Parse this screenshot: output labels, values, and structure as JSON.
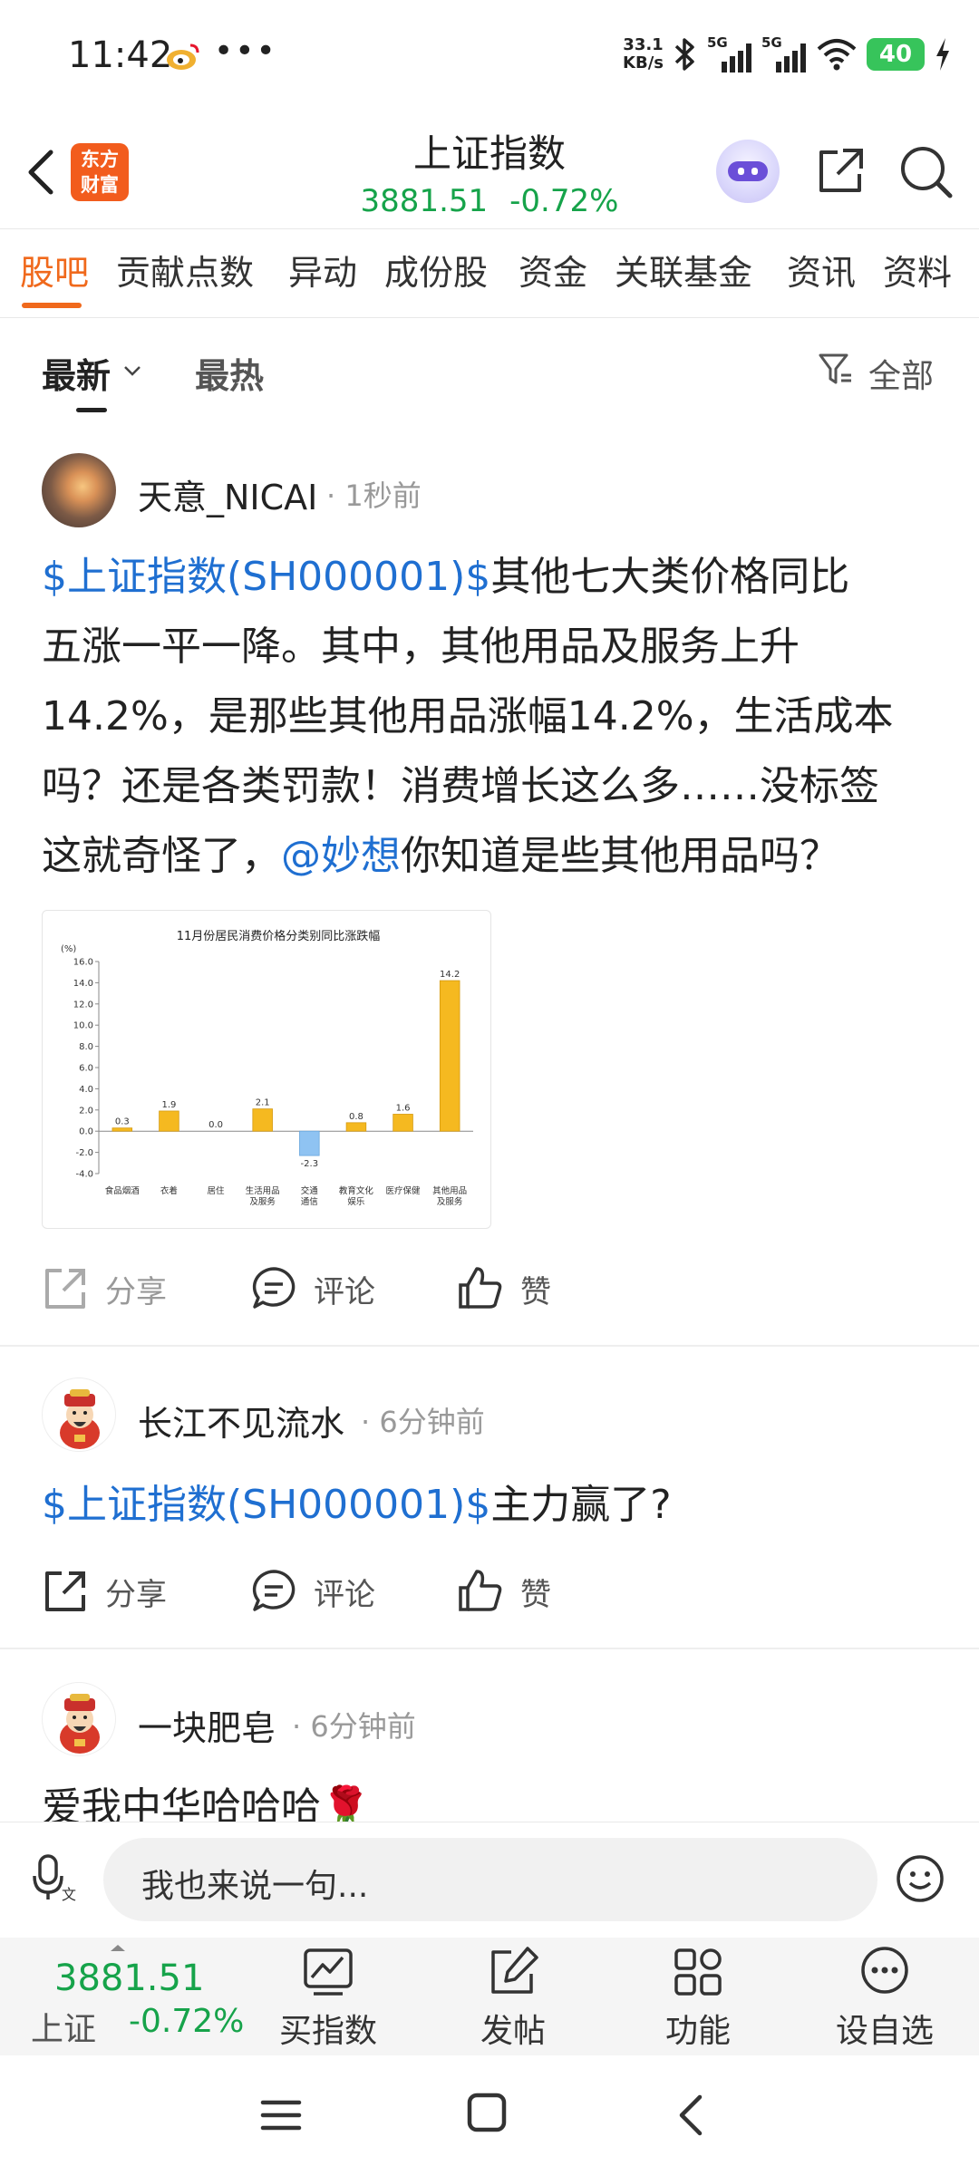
{
  "status_bar": {
    "time": "11:42",
    "net_speed_value": "33.1",
    "net_speed_unit": "KB/s",
    "battery": "40"
  },
  "header": {
    "logo_line1": "东方",
    "logo_line2": "财富",
    "title": "上证指数",
    "price": "3881.51",
    "change": "-0.72%"
  },
  "tabs": [
    "股吧",
    "贡献点数",
    "异动",
    "成份股",
    "资金",
    "关联基金",
    "资讯",
    "资料"
  ],
  "sort": {
    "latest": "最新",
    "hot": "最热",
    "filter": "全部"
  },
  "posts": [
    {
      "username": "天意_NICAI",
      "time": "· 1秒前",
      "link": "$上证指数(SH000001)$",
      "text_a": "其他七大类价格同比",
      "line2": "五涨一平一降。其中，其他用品及服务上升",
      "line3": "14.2%，是那些其他用品涨幅14.2%，生活成本",
      "line4": "吗？还是各类罚款！消费增长这么多……没标签",
      "line5_a": "这就奇怪了，",
      "mention": "@妙想",
      "line5_b": "你知道是些其他用品吗？",
      "share": "分享",
      "comment": "评论",
      "like": "赞"
    },
    {
      "username": "长江不见流水",
      "time": "· 6分钟前",
      "link": "$上证指数(SH000001)$",
      "text_a": "主力赢了?",
      "share": "分享",
      "comment": "评论",
      "like": "赞"
    },
    {
      "username": "一块肥皂",
      "time": "· 6分钟前",
      "text_a": "爱我中华哈哈哈🌹"
    }
  ],
  "chart_data": {
    "type": "bar",
    "title": "11月份居民消费价格分类别同比涨跌幅",
    "ylabel": "(%)",
    "ylim": [
      -4.0,
      16.0
    ],
    "yticks": [
      "16.0",
      "14.0",
      "12.0",
      "10.0",
      "8.0",
      "6.0",
      "4.0",
      "2.0",
      "0.0",
      "-2.0",
      "-4.0"
    ],
    "categories": [
      [
        "食品烟酒"
      ],
      [
        "衣着"
      ],
      [
        "居住"
      ],
      [
        "生活用品",
        "及服务"
      ],
      [
        "交通",
        "通信"
      ],
      [
        "教育文化",
        "娱乐"
      ],
      [
        "医疗保健"
      ],
      [
        "其他用品",
        "及服务"
      ]
    ],
    "values": [
      0.3,
      1.9,
      0.0,
      2.1,
      -2.3,
      0.8,
      1.6,
      14.2
    ],
    "value_labels": [
      "0.3",
      "1.9",
      "0.0",
      "2.1",
      "-2.3",
      "0.8",
      "1.6",
      "14.2"
    ],
    "colors": {
      "positive": "#f5b920",
      "negative": "#8fc3f2"
    }
  },
  "input": {
    "placeholder": "我也来说一句..."
  },
  "bottom_bar": {
    "price": "3881.51",
    "name": "上证",
    "change": "-0.72%",
    "buy_index": "买指数",
    "post": "发帖",
    "functions": "功能",
    "add_watch": "设自选"
  },
  "colors": {
    "accent": "#f0691c",
    "down": "#16a34a",
    "link": "#1f6fd1"
  }
}
